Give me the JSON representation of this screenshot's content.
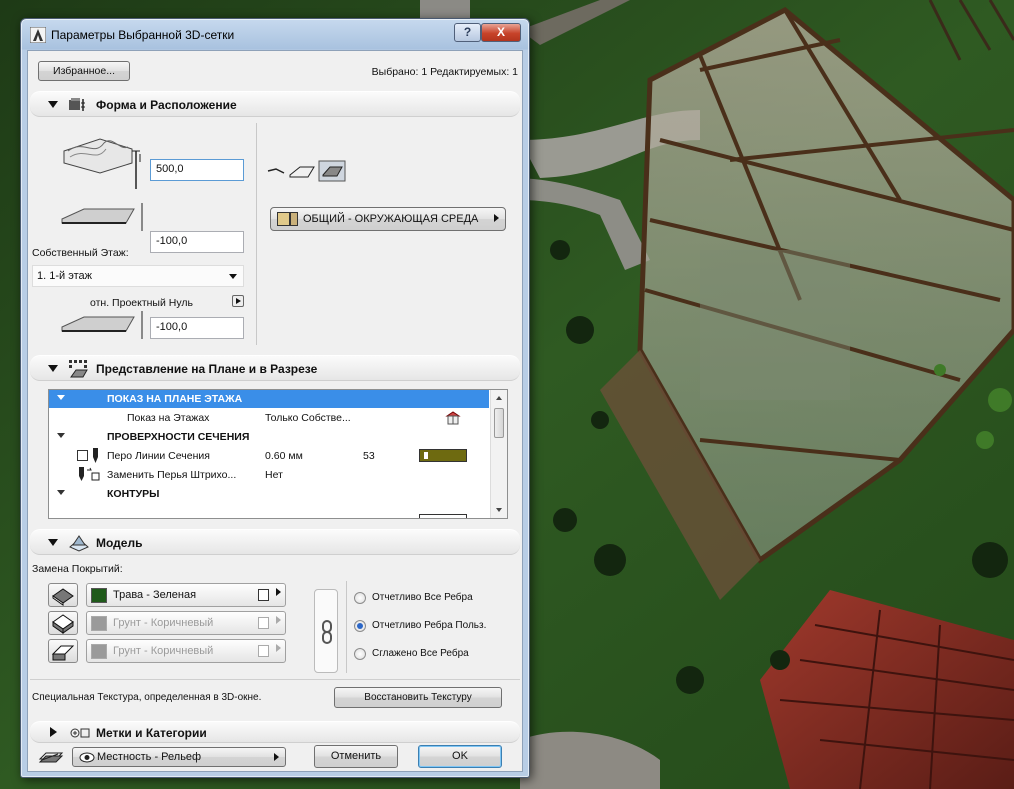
{
  "window": {
    "title": "Параметры Выбранной 3D-сетки",
    "help_label": "?",
    "close_label": "X"
  },
  "top": {
    "favorites_label": "Избранное...",
    "selection_info": "Выбрано: 1 Редактируемых: 1"
  },
  "shape": {
    "header": "Форма и Расположение",
    "top_value": "500,0",
    "bottom_value": "-100,0",
    "story_label": "Собственный Этаж:",
    "story_value": "1. 1-й этаж",
    "ref_label": "отн. Проектный Нуль",
    "ref_value": "-100,0",
    "surface_label": "ОБЩИЙ - ОКРУЖАЮЩАЯ СРЕДА"
  },
  "plan": {
    "header": "Представление на Плане и в Разрезе",
    "rows": [
      {
        "name": "ПОКАЗ НА ПЛАНЕ ЭТАЖА",
        "value": "",
        "extra": ""
      },
      {
        "name": "Показ на Этажах",
        "value": "Только Собстве...",
        "extra": ""
      },
      {
        "name": "ПРОВЕРХНОСТИ СЕЧЕНИЯ",
        "value": "",
        "extra": ""
      },
      {
        "name": "Перо Линии Сечения",
        "value": "0.60 мм",
        "extra": "53"
      },
      {
        "name": "Заменить Перья Штрихо...",
        "value": "Нет",
        "extra": ""
      },
      {
        "name": "КОНТУРЫ",
        "value": "",
        "extra": ""
      }
    ]
  },
  "model": {
    "header": "Модель",
    "override_label": "Замена Покрытий:",
    "materials": [
      {
        "name": "Трава - Зеленая",
        "color": "#1f5a1a"
      },
      {
        "name": "Грунт - Коричневый",
        "color": "#9a9a9a"
      },
      {
        "name": "Грунт - Коричневый",
        "color": "#9a9a9a"
      }
    ],
    "radios": [
      "Отчетливо Все Ребра",
      "Отчетливо Ребра Польз.",
      "Сглажено Все Ребра"
    ],
    "texture_note": "Специальная Текстура, определенная в 3D-окне.",
    "restore_label": "Восстановить Текстуру"
  },
  "tags": {
    "header": "Метки и Категории"
  },
  "footer": {
    "layer_label": "Местность - Рельеф",
    "cancel_label": "Отменить",
    "ok_label": "OK"
  },
  "colors": {
    "accent": "#3a8ee8",
    "pen_swatch": "#6e6a10",
    "grass": "#1f5a1a"
  }
}
